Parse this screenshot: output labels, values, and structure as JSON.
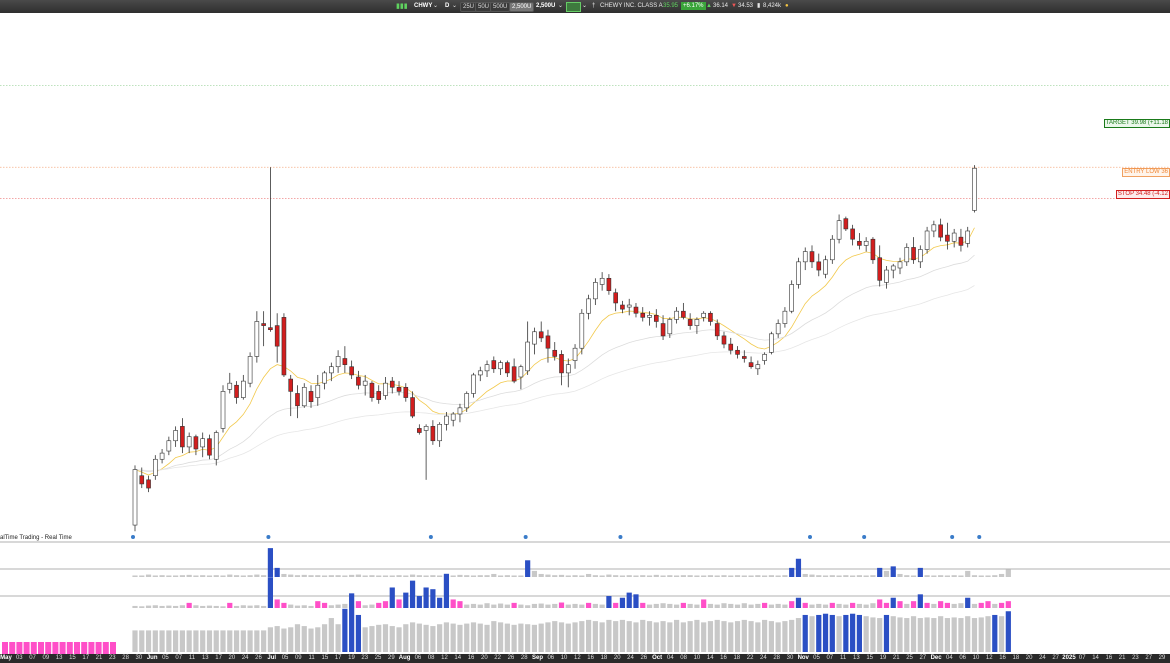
{
  "toolbar": {
    "symbol": "CHWY",
    "timeframe": "D",
    "unit_buttons": [
      "25U",
      "50U",
      "500U",
      "2,500U"
    ],
    "selected_unit": "2,500U",
    "quote": {
      "name": "CHEWY INC. CLASS A",
      "last": "35.95",
      "change": "+6.17%",
      "high": "36.14",
      "low": "34.53",
      "volume": "8,424k"
    },
    "icons": [
      "bars-icon",
      "chart-type-icon",
      "pin-icon",
      "status-dot-icon"
    ]
  },
  "levels": {
    "target": "TARGET 39.98 (+11.18",
    "entry": "ENTRY LOW 36",
    "stop": "STOP 34.48 (-4.12"
  },
  "colors": {
    "up": "#ffffff",
    "down": "#d21e1e",
    "ema_fast": "#f2c94c",
    "ema_slow": "#c8c8c8",
    "vol_blue": "#2b4fc4",
    "vol_pink": "#ff4fc8",
    "vol_gray": "#c8c8c8"
  },
  "realtime_label": "alTime Trading - Real Time",
  "date_axis": {
    "labels": [
      "May",
      "03",
      "07",
      "09",
      "13",
      "15",
      "17",
      "21",
      "23",
      "28",
      "30",
      "Jun",
      "05",
      "07",
      "11",
      "13",
      "17",
      "20",
      "24",
      "26",
      "Jul",
      "05",
      "09",
      "11",
      "15",
      "17",
      "19",
      "23",
      "25",
      "29",
      "Aug",
      "06",
      "08",
      "12",
      "14",
      "16",
      "20",
      "22",
      "26",
      "28",
      "Sep",
      "06",
      "10",
      "12",
      "16",
      "18",
      "20",
      "24",
      "26",
      "Oct",
      "04",
      "08",
      "10",
      "14",
      "16",
      "18",
      "22",
      "24",
      "28",
      "30",
      "Nov",
      "05",
      "07",
      "11",
      "13",
      "15",
      "19",
      "21",
      "25",
      "27",
      "Dec",
      "04",
      "06",
      "10",
      "12",
      "16",
      "18",
      "20",
      "24",
      "27",
      "2025",
      "07",
      "14",
      "16",
      "21",
      "23",
      "27",
      "29"
    ],
    "months": [
      "May",
      "Jun",
      "Jul",
      "Aug",
      "Sep",
      "Oct",
      "Nov",
      "Dec",
      "2025"
    ]
  },
  "chart_data": {
    "type": "candlestick",
    "symbol": "CHWY",
    "interval": "D",
    "levels": {
      "target": 39.98,
      "entry_low": 36,
      "stop": 34.48
    },
    "last_quote": {
      "last": 35.95,
      "change_pct": 6.17,
      "high": 36.14,
      "low": 34.53,
      "volume_k": 8424
    },
    "candles": [
      [
        18.6,
        21.5,
        18.3,
        21.3
      ],
      [
        21.0,
        21.4,
        20.4,
        20.6
      ],
      [
        20.8,
        21.0,
        20.2,
        20.4
      ],
      [
        21.0,
        22.0,
        20.8,
        21.8
      ],
      [
        21.8,
        22.3,
        21.6,
        22.1
      ],
      [
        22.2,
        22.9,
        22.0,
        22.7
      ],
      [
        22.7,
        23.4,
        22.4,
        23.2
      ],
      [
        23.4,
        23.8,
        22.1,
        22.4
      ],
      [
        22.4,
        23.1,
        22.1,
        22.9
      ],
      [
        22.9,
        23.0,
        22.0,
        22.3
      ],
      [
        22.4,
        23.1,
        21.9,
        22.8
      ],
      [
        22.8,
        23.0,
        21.8,
        22.0
      ],
      [
        21.8,
        23.2,
        21.5,
        23.1
      ],
      [
        23.3,
        25.4,
        23.1,
        25.1
      ],
      [
        25.2,
        26.0,
        25.0,
        25.5
      ],
      [
        25.4,
        25.6,
        24.5,
        24.8
      ],
      [
        24.8,
        25.9,
        24.7,
        25.6
      ],
      [
        25.5,
        27.0,
        25.3,
        26.8
      ],
      [
        26.8,
        29.0,
        26.5,
        28.5
      ],
      [
        28.4,
        29.0,
        27.3,
        28.3
      ],
      [
        28.2,
        36.0,
        28.0,
        28.1
      ],
      [
        28.3,
        28.9,
        26.5,
        27.3
      ],
      [
        28.7,
        28.9,
        25.8,
        25.9
      ],
      [
        25.7,
        25.9,
        23.9,
        25.1
      ],
      [
        25.0,
        25.4,
        23.8,
        24.4
      ],
      [
        24.4,
        25.5,
        24.3,
        25.3
      ],
      [
        25.1,
        25.4,
        24.3,
        24.6
      ],
      [
        24.8,
        25.9,
        24.4,
        25.4
      ],
      [
        25.5,
        26.1,
        25.2,
        26.0
      ],
      [
        26.0,
        26.5,
        25.6,
        26.3
      ],
      [
        26.3,
        27.1,
        26.0,
        26.8
      ],
      [
        26.7,
        27.3,
        26.0,
        26.4
      ],
      [
        26.3,
        26.6,
        25.7,
        25.9
      ],
      [
        25.8,
        26.1,
        25.2,
        25.4
      ],
      [
        25.4,
        25.9,
        24.9,
        25.6
      ],
      [
        25.5,
        25.6,
        24.6,
        24.8
      ],
      [
        25.1,
        25.4,
        24.5,
        24.7
      ],
      [
        24.9,
        25.8,
        24.7,
        25.5
      ],
      [
        25.6,
        25.8,
        25.0,
        25.3
      ],
      [
        25.3,
        25.6,
        24.9,
        25.1
      ],
      [
        25.3,
        25.5,
        24.6,
        24.8
      ],
      [
        24.8,
        25.1,
        23.8,
        23.9
      ],
      [
        23.3,
        23.5,
        23.0,
        23.1
      ],
      [
        23.2,
        23.5,
        20.8,
        23.4
      ],
      [
        23.4,
        23.7,
        22.5,
        22.7
      ],
      [
        22.7,
        23.6,
        22.4,
        23.5
      ],
      [
        23.5,
        24.1,
        23.2,
        23.9
      ],
      [
        23.7,
        24.1,
        23.4,
        24.0
      ],
      [
        24.0,
        24.5,
        23.6,
        24.3
      ],
      [
        24.3,
        25.1,
        24.1,
        25.0
      ],
      [
        25.0,
        26.0,
        24.8,
        25.9
      ],
      [
        25.9,
        26.3,
        25.6,
        26.1
      ],
      [
        26.1,
        26.6,
        25.8,
        26.4
      ],
      [
        26.6,
        26.8,
        26.0,
        26.2
      ],
      [
        26.2,
        26.6,
        25.9,
        26.5
      ],
      [
        26.5,
        26.6,
        25.8,
        26.0
      ],
      [
        26.3,
        26.7,
        25.5,
        25.6
      ],
      [
        25.8,
        26.4,
        25.2,
        26.3
      ],
      [
        26.1,
        28.5,
        25.9,
        27.5
      ],
      [
        27.4,
        28.2,
        26.9,
        28.0
      ],
      [
        28.0,
        28.5,
        27.5,
        27.7
      ],
      [
        27.8,
        28.1,
        26.5,
        27.2
      ],
      [
        27.1,
        27.5,
        26.6,
        26.8
      ],
      [
        26.9,
        27.1,
        25.4,
        26.0
      ],
      [
        26.0,
        26.7,
        25.3,
        26.4
      ],
      [
        26.6,
        27.4,
        26.2,
        27.2
      ],
      [
        27.2,
        29.1,
        26.9,
        28.9
      ],
      [
        28.9,
        29.8,
        28.6,
        29.6
      ],
      [
        29.6,
        30.6,
        29.3,
        30.4
      ],
      [
        30.3,
        30.9,
        30.0,
        30.6
      ],
      [
        30.6,
        30.8,
        29.8,
        30.0
      ],
      [
        29.9,
        30.1,
        29.0,
        29.4
      ],
      [
        29.3,
        29.5,
        28.9,
        29.1
      ],
      [
        29.2,
        29.6,
        28.8,
        29.3
      ],
      [
        29.2,
        29.4,
        28.7,
        28.9
      ],
      [
        28.9,
        29.2,
        28.5,
        28.7
      ],
      [
        28.7,
        29.0,
        28.3,
        28.8
      ],
      [
        28.8,
        29.1,
        28.2,
        28.5
      ],
      [
        28.4,
        28.8,
        27.6,
        27.8
      ],
      [
        27.9,
        28.7,
        27.7,
        28.6
      ],
      [
        28.6,
        29.2,
        28.4,
        29.0
      ],
      [
        29.0,
        29.4,
        28.6,
        28.7
      ],
      [
        28.6,
        28.9,
        28.1,
        28.3
      ],
      [
        28.3,
        28.7,
        27.9,
        28.6
      ],
      [
        28.7,
        29.0,
        28.5,
        28.9
      ],
      [
        28.9,
        29.0,
        28.3,
        28.5
      ],
      [
        28.4,
        28.6,
        27.6,
        27.8
      ],
      [
        27.8,
        28.0,
        27.2,
        27.4
      ],
      [
        27.4,
        27.7,
        26.9,
        27.1
      ],
      [
        27.1,
        27.3,
        26.7,
        26.9
      ],
      [
        26.8,
        27.1,
        26.5,
        26.7
      ],
      [
        26.5,
        26.8,
        26.2,
        26.3
      ],
      [
        26.2,
        26.6,
        25.9,
        26.4
      ],
      [
        26.6,
        27.0,
        26.4,
        26.9
      ],
      [
        27.0,
        28.0,
        26.9,
        27.9
      ],
      [
        27.9,
        28.6,
        27.7,
        28.4
      ],
      [
        28.4,
        29.2,
        28.2,
        29.0
      ],
      [
        29.0,
        30.5,
        28.9,
        30.3
      ],
      [
        30.3,
        31.6,
        30.1,
        31.4
      ],
      [
        31.4,
        32.1,
        31.0,
        31.9
      ],
      [
        31.9,
        32.2,
        31.1,
        31.4
      ],
      [
        31.4,
        31.8,
        30.7,
        31.0
      ],
      [
        30.8,
        31.7,
        30.6,
        31.5
      ],
      [
        31.5,
        32.7,
        31.3,
        32.5
      ],
      [
        32.5,
        33.7,
        32.3,
        33.4
      ],
      [
        33.5,
        33.6,
        32.9,
        33.0
      ],
      [
        33.0,
        33.2,
        32.2,
        32.5
      ],
      [
        32.4,
        32.8,
        32.0,
        32.2
      ],
      [
        32.2,
        32.6,
        31.9,
        32.4
      ],
      [
        32.5,
        32.6,
        31.3,
        31.5
      ],
      [
        31.6,
        32.2,
        30.2,
        30.5
      ],
      [
        30.4,
        31.2,
        30.1,
        31.0
      ],
      [
        31.0,
        31.3,
        30.6,
        31.2
      ],
      [
        31.1,
        31.6,
        30.8,
        31.4
      ],
      [
        31.4,
        32.3,
        31.2,
        32.1
      ],
      [
        32.1,
        32.6,
        31.3,
        31.5
      ],
      [
        31.4,
        32.2,
        31.1,
        32.0
      ],
      [
        32.0,
        33.1,
        31.8,
        32.9
      ],
      [
        32.9,
        33.4,
        32.6,
        33.2
      ],
      [
        33.2,
        33.5,
        32.4,
        32.6
      ],
      [
        32.7,
        33.3,
        32.0,
        32.4
      ],
      [
        32.4,
        33.0,
        32.1,
        32.8
      ],
      [
        32.6,
        33.0,
        31.9,
        32.2
      ],
      [
        32.3,
        33.1,
        32.1,
        32.9
      ],
      [
        33.9,
        36.1,
        33.8,
        35.95
      ]
    ],
    "volume_panels": [
      [
        0.05,
        0.05,
        0.08,
        0.05,
        0.06,
        0.05,
        0.05,
        0.06,
        0.07,
        0.05,
        0.06,
        0.05,
        0.06,
        0.05,
        0.08,
        0.06,
        0.05,
        0.06,
        0.08,
        0.06,
        0.95,
        0.3,
        0.1,
        0.08,
        0.06,
        0.07,
        0.06,
        0.06,
        0.05,
        0.06,
        0.06,
        0.05,
        0.07,
        0.08,
        0.05,
        0.06,
        0.05,
        0.05,
        0.05,
        0.06,
        0.05,
        0.08,
        0.06,
        0.05,
        0.06,
        0.05,
        0.06,
        0.05,
        0.07,
        0.06,
        0.05,
        0.06,
        0.06,
        0.1,
        0.05,
        0.06,
        0.05,
        0.05,
        0.55,
        0.2,
        0.1,
        0.08,
        0.06,
        0.07,
        0.05,
        0.06,
        0.05,
        0.1,
        0.06,
        0.05,
        0.08,
        0.06,
        0.05,
        0.06,
        0.05,
        0.06,
        0.05,
        0.07,
        0.05,
        0.06,
        0.05,
        0.06,
        0.06,
        0.05,
        0.05,
        0.06,
        0.05,
        0.06,
        0.05,
        0.06,
        0.05,
        0.05,
        0.06,
        0.05,
        0.06,
        0.05,
        0.06,
        0.3,
        0.6,
        0.1,
        0.08,
        0.06,
        0.05,
        0.06,
        0.05,
        0.06,
        0.05,
        0.06,
        0.05,
        0.06,
        0.3,
        0.2,
        0.35,
        0.1,
        0.06,
        0.05,
        0.3,
        0.06,
        0.05,
        0.06,
        0.05,
        0.06,
        0.05,
        0.2,
        0.06,
        0.05,
        0.05,
        0.06,
        0.1,
        0.25
      ],
      [
        0.06,
        0.05,
        0.07,
        0.08,
        0.06,
        0.07,
        0.06,
        0.08,
        0.15,
        0.08,
        0.06,
        0.07,
        0.06,
        0.05,
        0.15,
        0.06,
        0.08,
        0.07,
        0.08,
        0.06,
        0.9,
        0.25,
        0.15,
        0.1,
        0.07,
        0.08,
        0.06,
        0.2,
        0.15,
        0.08,
        0.1,
        0.12,
        0.07,
        0.2,
        0.08,
        0.1,
        0.15,
        0.2,
        0.6,
        0.25,
        0.45,
        0.8,
        0.35,
        0.6,
        0.55,
        0.3,
        1.0,
        0.25,
        0.2,
        0.1,
        0.12,
        0.1,
        0.14,
        0.1,
        0.13,
        0.1,
        0.15,
        0.1,
        0.08,
        0.12,
        0.13,
        0.1,
        0.12,
        0.16,
        0.1,
        0.12,
        0.1,
        0.15,
        0.12,
        0.1,
        0.35,
        0.15,
        0.3,
        0.45,
        0.4,
        0.15,
        0.1,
        0.12,
        0.14,
        0.12,
        0.1,
        0.15,
        0.12,
        0.1,
        0.25,
        0.12,
        0.1,
        0.14,
        0.12,
        0.1,
        0.14,
        0.1,
        0.12,
        0.15,
        0.1,
        0.12,
        0.1,
        0.2,
        0.3,
        0.15,
        0.1,
        0.12,
        0.1,
        0.15,
        0.12,
        0.1,
        0.15,
        0.12,
        0.1,
        0.14,
        0.25,
        0.15,
        0.3,
        0.2,
        0.12,
        0.2,
        0.4,
        0.15,
        0.12,
        0.2,
        0.15,
        0.12,
        0.14,
        0.3,
        0.12,
        0.15,
        0.2,
        0.12,
        0.15,
        0.2
      ],
      [
        0.35,
        0.35,
        0.35,
        0.35,
        0.35,
        0.35,
        0.35,
        0.35,
        0.35,
        0.35,
        0.35,
        0.35,
        0.35,
        0.35,
        0.35,
        0.35,
        0.35,
        0.35,
        0.35,
        0.35,
        0.4,
        0.42,
        0.38,
        0.4,
        0.45,
        0.42,
        0.38,
        0.4,
        0.45,
        0.55,
        0.45,
        0.7,
        0.95,
        0.6,
        0.4,
        0.42,
        0.44,
        0.45,
        0.42,
        0.4,
        0.45,
        0.48,
        0.46,
        0.44,
        0.42,
        0.45,
        0.48,
        0.46,
        0.44,
        0.46,
        0.48,
        0.46,
        0.44,
        0.5,
        0.48,
        0.46,
        0.44,
        0.46,
        0.45,
        0.44,
        0.46,
        0.48,
        0.5,
        0.48,
        0.46,
        0.48,
        0.5,
        0.52,
        0.5,
        0.48,
        0.52,
        0.5,
        0.52,
        0.5,
        0.48,
        0.52,
        0.5,
        0.48,
        0.5,
        0.48,
        0.52,
        0.48,
        0.5,
        0.52,
        0.48,
        0.5,
        0.52,
        0.5,
        0.48,
        0.5,
        0.52,
        0.5,
        0.48,
        0.52,
        0.5,
        0.48,
        0.5,
        0.52,
        0.55,
        0.6,
        0.58,
        0.6,
        0.62,
        0.6,
        0.58,
        0.6,
        0.62,
        0.6,
        0.58,
        0.56,
        0.55,
        0.6,
        0.58,
        0.56,
        0.55,
        0.58,
        0.55,
        0.56,
        0.55,
        0.58,
        0.55,
        0.56,
        0.55,
        0.58,
        0.55,
        0.56,
        0.58,
        0.6,
        0.58,
        0.66
      ]
    ],
    "y_range": [
      20.5,
      43.5
    ]
  }
}
